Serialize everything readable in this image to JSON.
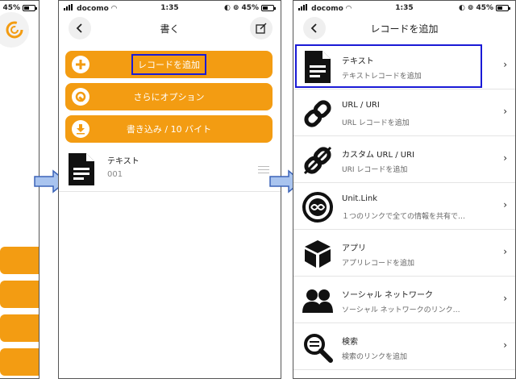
{
  "status": {
    "battery": "45%",
    "carrier": "docomo",
    "time": "1:35"
  },
  "panel2": {
    "title": "書く",
    "buttons": [
      {
        "label": "レコードを追加"
      },
      {
        "label": "さらにオプション"
      },
      {
        "label": "書き込み / 10 バイト"
      }
    ],
    "record": {
      "title": "テキスト",
      "index": "001"
    }
  },
  "panel3": {
    "title": "レコードを追加",
    "items": [
      {
        "title": "テキスト",
        "sub": "テキストレコードを追加",
        "icon": "document-icon"
      },
      {
        "title": "URL / URI",
        "sub": "URL レコードを追加",
        "icon": "link-icon"
      },
      {
        "title": "カスタム URL / URI",
        "sub": "URI レコードを追加",
        "icon": "custom-link-icon"
      },
      {
        "title": "Unit.Link",
        "sub": "１つのリンクで全ての情報を共有で…",
        "icon": "unit-link-icon"
      },
      {
        "title": "アプリ",
        "sub": "アプリレコードを追加",
        "icon": "cube-icon"
      },
      {
        "title": "ソーシャル ネットワーク",
        "sub": "ソーシャル ネットワークのリンク…",
        "icon": "people-icon"
      },
      {
        "title": "検索",
        "sub": "検索のリンクを追加",
        "icon": "search-icon"
      }
    ]
  },
  "colors": {
    "accent": "#f39c12",
    "highlight": "#1a1ad6",
    "arrow": "#a9c4ef"
  }
}
